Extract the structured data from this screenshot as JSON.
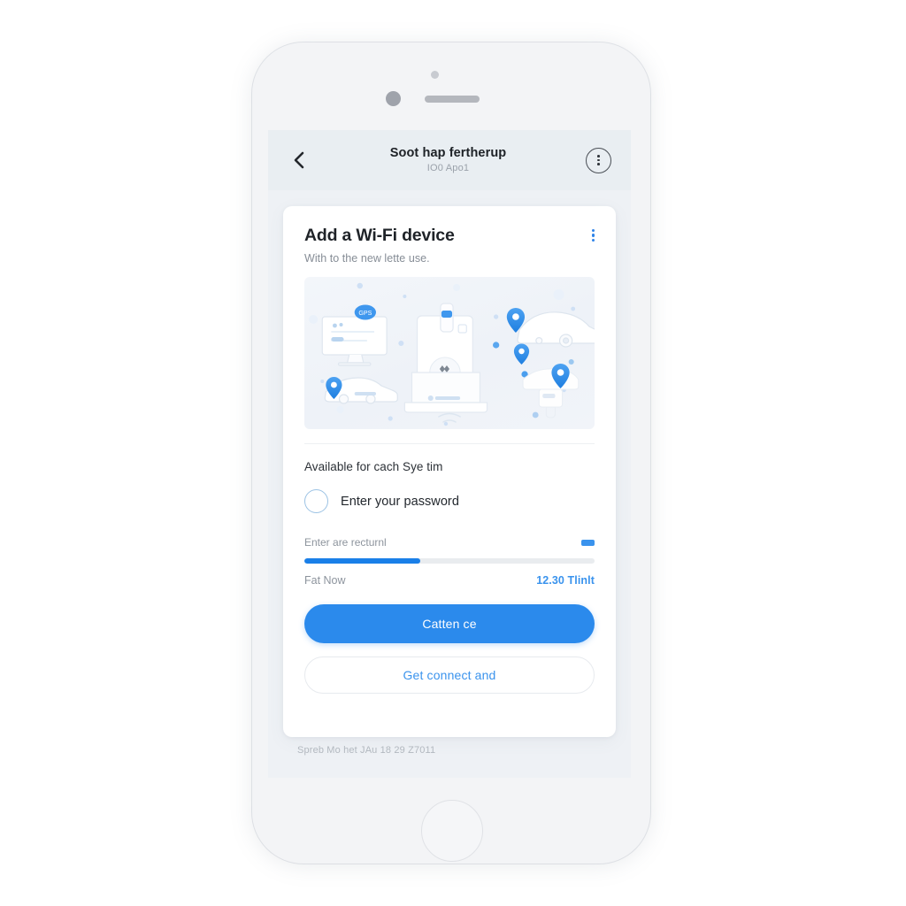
{
  "app": {
    "header": {
      "back_icon": "chevron-left-icon",
      "title": "Soot hap fertherup",
      "subtitle": "IO0 Apo1",
      "menu_icon": "circled-kebab-menu-icon"
    },
    "card": {
      "title": "Add a Wi-Fi device",
      "subtitle": "With to the new lette use.",
      "menu_icon": "kebab-menu-icon",
      "illustration": {
        "name": "connected-devices-illustration",
        "elements": [
          "monitor",
          "car",
          "sports-car",
          "central-router-device",
          "appliance",
          "location-pins",
          "dots"
        ]
      },
      "availability_label": "Available for cach Sye tim",
      "password_option": {
        "label": "Enter your password",
        "selected": false
      },
      "progress": {
        "caption": "Enter are recturnl",
        "percent": 40,
        "status": "Fat Now",
        "value": "12.30 Tlinlt",
        "badge_color": "#3a93ed",
        "fill_color": "#1a7fe8"
      },
      "primary_button": "Catten ce",
      "secondary_button": "Get connect and"
    },
    "footer": "Spreb Mo het JAu 18 29 Z7011"
  },
  "device": {
    "earpiece": "earpiece-speaker",
    "camera": "front-camera",
    "sensor": "proximity-sensor",
    "home": "home-button"
  },
  "colors": {
    "accent": "#2b8aec",
    "accent_dark": "#1a7fe8",
    "screen_bg": "#eef1f5",
    "header_bg": "#e9eef2"
  }
}
